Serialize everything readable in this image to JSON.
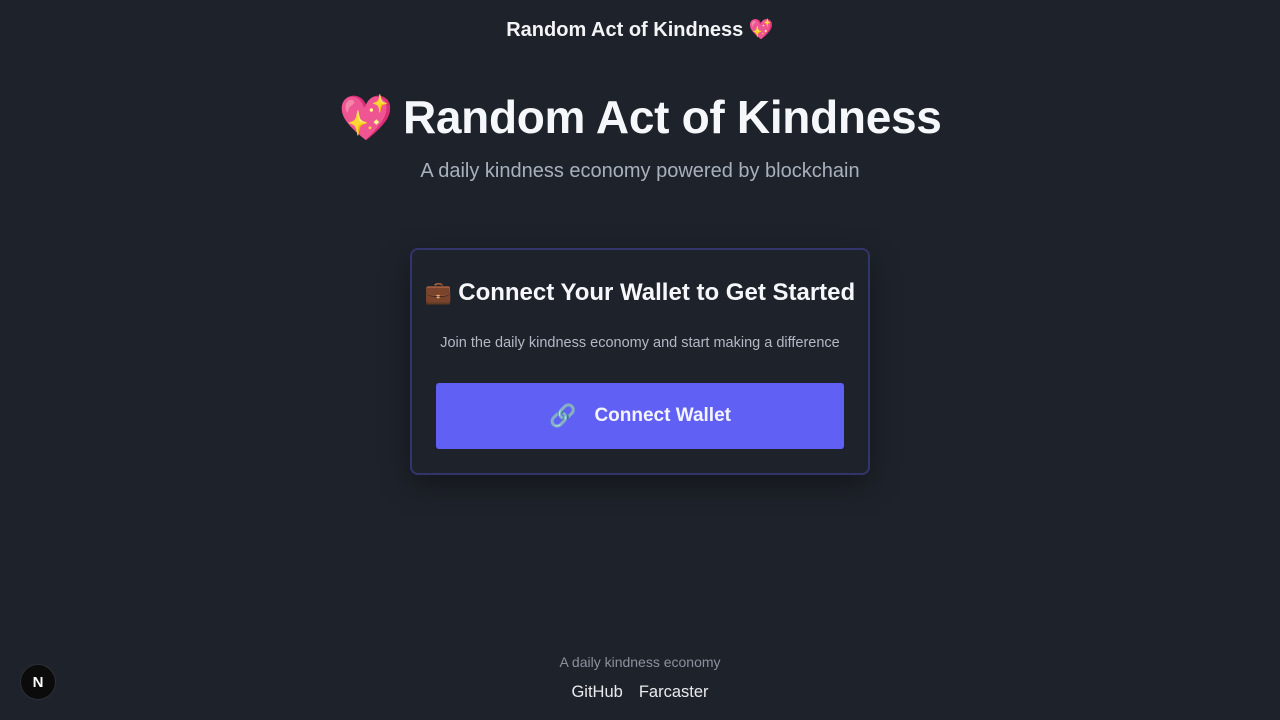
{
  "header": {
    "title": "Random Act of Kindness 💖"
  },
  "hero": {
    "emoji": "💖",
    "title": "Random Act of Kindness",
    "subtitle": "A daily kindness economy powered by blockchain"
  },
  "card": {
    "emoji": "💼",
    "title": "Connect Your Wallet to Get Started",
    "description": "Join the daily kindness economy and start making a difference",
    "button_emoji": "🔗",
    "button_label": "Connect Wallet",
    "border_color": "#33346a",
    "button_color": "#6160f5"
  },
  "footer": {
    "tagline": "A daily kindness economy",
    "links": [
      "GitHub",
      "Farcaster"
    ]
  },
  "badge": {
    "label": "N"
  }
}
